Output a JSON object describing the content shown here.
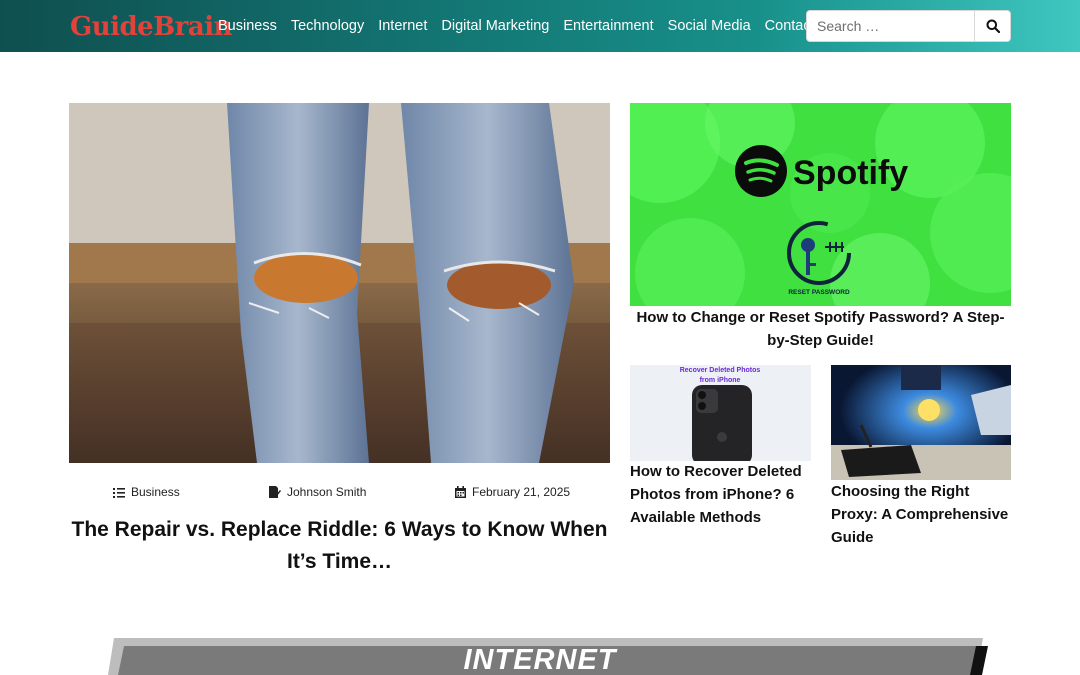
{
  "header": {
    "logo": "GuideBrain",
    "nav": [
      "Business",
      "Technology",
      "Internet",
      "Digital Marketing",
      "Entertainment",
      "Social Media",
      "Contact Us"
    ],
    "search_placeholder": "Search …"
  },
  "featured": {
    "category": "Business",
    "author": "Johnson Smith",
    "date": "February 21, 2025",
    "title": "The Repair vs. Replace Riddle: 6 Ways to Know When It’s Time…"
  },
  "side_posts": {
    "spotify": {
      "image_logo": "Spotify",
      "image_caption": "RESET PASSWORD",
      "title": "How to Change or Reset Spotify Password? A Step-by-Step Guide!"
    },
    "iphone": {
      "image_caption_line1": "Recover Deleted Photos",
      "image_caption_line2": "from iPhone",
      "title": "How to Recover Deleted Photos from iPhone? 6 Available Methods"
    },
    "proxy": {
      "title": "Choosing the Right Proxy: A Comprehensive Guide"
    }
  },
  "section": {
    "label": "INTERNET"
  },
  "colors": {
    "header_start": "#0f4f4f",
    "header_end": "#3fc7c0",
    "logo": "#e3423a",
    "spotify_green": "#47e84a",
    "banner_gray": "#7a7a7a"
  },
  "icons": [
    "search-icon",
    "list-icon",
    "author-icon",
    "calendar-icon",
    "spotify-logo-icon",
    "key-reset-icon"
  ]
}
